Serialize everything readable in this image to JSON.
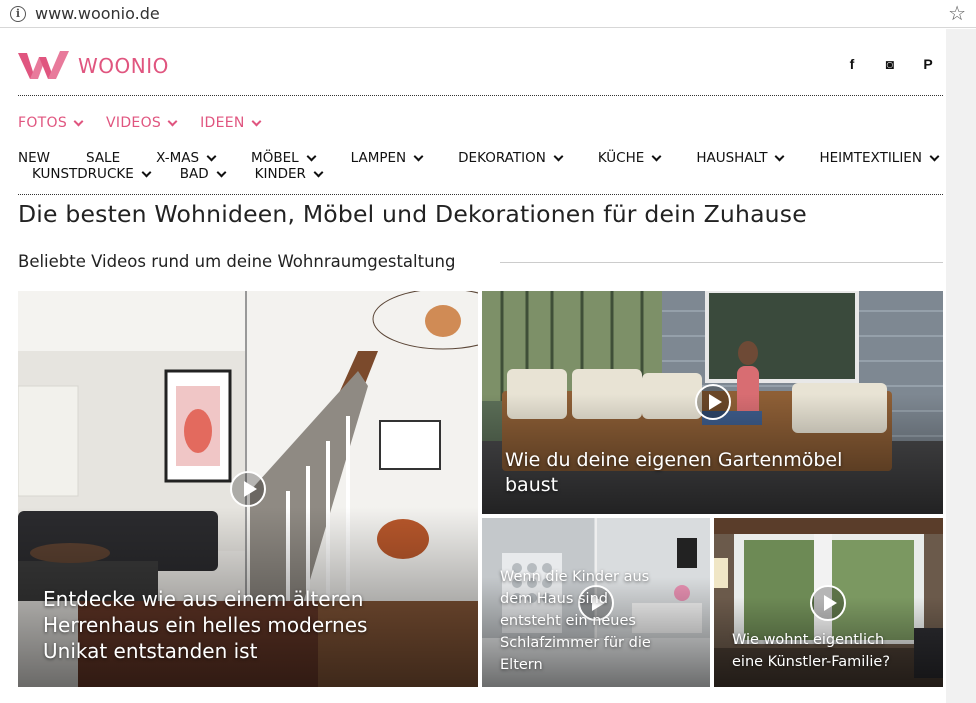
{
  "browser": {
    "url": "www.woonio.de",
    "info_icon": "info-icon",
    "bookmark_icon": "star-icon"
  },
  "brand": {
    "name": "WOONIO",
    "color": "#e0557f"
  },
  "social": [
    {
      "icon": "facebook-icon",
      "glyph": "f"
    },
    {
      "icon": "instagram-icon",
      "glyph": "◙"
    },
    {
      "icon": "pinterest-icon",
      "glyph": "P"
    }
  ],
  "pink_nav": [
    "FOTOS",
    "VIDEOS",
    "IDEEN"
  ],
  "category_nav": {
    "row1": [
      {
        "label": "NEW",
        "dropdown": false
      },
      {
        "label": "SALE",
        "dropdown": false
      },
      {
        "label": "X-MAS",
        "dropdown": true
      },
      {
        "label": "MÖBEL",
        "dropdown": true
      },
      {
        "label": "LAMPEN",
        "dropdown": true
      },
      {
        "label": "DEKORATION",
        "dropdown": true
      },
      {
        "label": "KÜCHE",
        "dropdown": true
      },
      {
        "label": "HAUSHALT",
        "dropdown": true
      },
      {
        "label": "HEIMTEXTILIEN",
        "dropdown": true
      }
    ],
    "row2": [
      {
        "label": "KUNSTDRUCKE",
        "dropdown": true
      },
      {
        "label": "BAD",
        "dropdown": true
      },
      {
        "label": "KINDER",
        "dropdown": true
      }
    ]
  },
  "page_title": "Die besten Wohnideen, Möbel und Dekorationen für dein Zuhause",
  "section_title": "Beliebte Videos rund um deine Wohnraumgestaltung",
  "videos": [
    {
      "caption_lines": [
        "Entdecke wie aus einem älteren",
        "Herrenhaus ein helles modernes",
        "Unikat entstanden ist"
      ]
    },
    {
      "caption_lines": [
        "Wie du deine eigenen Gartenmöbel",
        "baust"
      ]
    },
    {
      "caption_lines": [
        "Wenn die Kinder aus",
        "dem Haus sind",
        "entsteht ein neues",
        "Schlafzimmer für die",
        "Eltern"
      ]
    },
    {
      "caption_lines": [
        "Wie wohnt eigentlich",
        "eine Künstler-Familie?"
      ]
    }
  ]
}
